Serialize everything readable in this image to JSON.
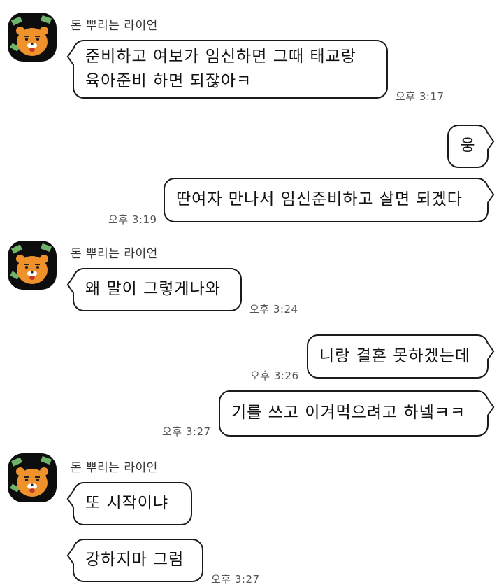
{
  "chat": {
    "contact_name": "돈 뿌리는 라이언",
    "avatar_icon": "ryan-money-icon",
    "messages": [
      {
        "from": "them",
        "text": "준비하고 여보가 임신하면 그때 태교랑\n육아준비 하면 되잖아ㅋ",
        "time": "오후 3:17"
      },
      {
        "from": "me",
        "text": "웅",
        "time": ""
      },
      {
        "from": "me",
        "text": "딴여자 만나서 임신준비하고 살면 되겠다",
        "time": "오후 3:19"
      },
      {
        "from": "them",
        "text": "왜 말이 그렇게나와",
        "time": "오후 3:24"
      },
      {
        "from": "me",
        "text": "니랑 결혼 못하겠는데",
        "time": "오후 3:26"
      },
      {
        "from": "me",
        "text": "기를 쓰고 이겨먹으려고 하넼ㅋㅋ",
        "time": "오후 3:27"
      },
      {
        "from": "them",
        "text": "또 시작이냐",
        "time": ""
      },
      {
        "from": "them",
        "text": "강하지마 그럼",
        "time": "오후 3:27"
      }
    ]
  }
}
